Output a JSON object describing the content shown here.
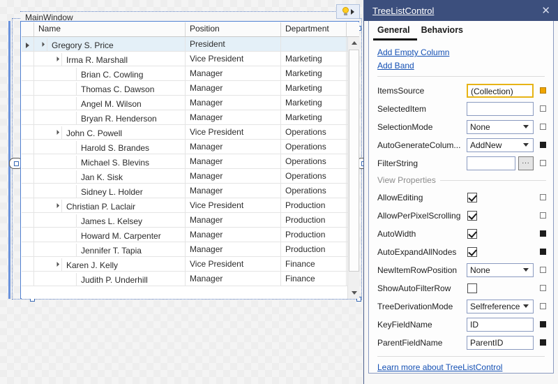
{
  "designer": {
    "window_label": "MainWindow",
    "smart_tag": {
      "bulb_icon": "lightbulb-icon",
      "arrow_icon": "triangle-right-icon"
    }
  },
  "treelist": {
    "columns": [
      "Name",
      "Position",
      "Department"
    ],
    "rows": [
      {
        "level": 0,
        "name": "Gregory S. Price",
        "position": "President",
        "department": "",
        "expander": true,
        "indicator": true,
        "selected": true
      },
      {
        "level": 1,
        "name": "Irma R. Marshall",
        "position": "Vice President",
        "department": "Marketing",
        "expander": true,
        "indicator": false,
        "selected": false
      },
      {
        "level": 2,
        "name": "Brian C. Cowling",
        "position": "Manager",
        "department": "Marketing",
        "expander": false,
        "indicator": false,
        "selected": false
      },
      {
        "level": 2,
        "name": "Thomas C. Dawson",
        "position": "Manager",
        "department": "Marketing",
        "expander": false,
        "indicator": false,
        "selected": false
      },
      {
        "level": 2,
        "name": "Angel M. Wilson",
        "position": "Manager",
        "department": "Marketing",
        "expander": false,
        "indicator": false,
        "selected": false
      },
      {
        "level": 2,
        "name": "Bryan R. Henderson",
        "position": "Manager",
        "department": "Marketing",
        "expander": false,
        "indicator": false,
        "selected": false
      },
      {
        "level": 1,
        "name": "John C. Powell",
        "position": "Vice President",
        "department": "Operations",
        "expander": true,
        "indicator": false,
        "selected": false
      },
      {
        "level": 2,
        "name": "Harold S. Brandes",
        "position": "Manager",
        "department": "Operations",
        "expander": false,
        "indicator": false,
        "selected": false
      },
      {
        "level": 2,
        "name": "Michael S. Blevins",
        "position": "Manager",
        "department": "Operations",
        "expander": false,
        "indicator": false,
        "selected": false
      },
      {
        "level": 2,
        "name": "Jan K. Sisk",
        "position": "Manager",
        "department": "Operations",
        "expander": false,
        "indicator": false,
        "selected": false
      },
      {
        "level": 2,
        "name": "Sidney L. Holder",
        "position": "Manager",
        "department": "Operations",
        "expander": false,
        "indicator": false,
        "selected": false
      },
      {
        "level": 1,
        "name": "Christian P. Laclair",
        "position": "Vice President",
        "department": "Production",
        "expander": true,
        "indicator": false,
        "selected": false
      },
      {
        "level": 2,
        "name": "James L. Kelsey",
        "position": "Manager",
        "department": "Production",
        "expander": false,
        "indicator": false,
        "selected": false
      },
      {
        "level": 2,
        "name": "Howard M. Carpenter",
        "position": "Manager",
        "department": "Production",
        "expander": false,
        "indicator": false,
        "selected": false
      },
      {
        "level": 2,
        "name": "Jennifer T. Tapia",
        "position": "Manager",
        "department": "Production",
        "expander": false,
        "indicator": false,
        "selected": false
      },
      {
        "level": 1,
        "name": "Karen J. Kelly",
        "position": "Vice President",
        "department": "Finance",
        "expander": true,
        "indicator": false,
        "selected": false
      },
      {
        "level": 2,
        "name": "Judith P. Underhill",
        "position": "Manager",
        "department": "Finance",
        "expander": false,
        "indicator": false,
        "selected": false
      }
    ]
  },
  "panel": {
    "title": "TreeListControl",
    "close_label": "✕",
    "tabs": [
      {
        "label": "General",
        "active": true
      },
      {
        "label": "Behaviors",
        "active": false
      }
    ],
    "actions": [
      {
        "label": "Add Empty Column"
      },
      {
        "label": "Add Band"
      }
    ],
    "properties": [
      {
        "label": "ItemsSource",
        "type": "text",
        "value": "(Collection)",
        "highlight": true,
        "marker": "orange"
      },
      {
        "label": "SelectedItem",
        "type": "text",
        "value": "",
        "highlight": false,
        "marker": "empty"
      },
      {
        "label": "SelectionMode",
        "type": "combo",
        "value": "None",
        "marker": "empty"
      },
      {
        "label": "AutoGenerateColum...",
        "type": "combo",
        "value": "AddNew",
        "marker": "black"
      },
      {
        "label": "FilterString",
        "type": "text-btn",
        "value": "",
        "button": "...",
        "marker": "empty"
      }
    ],
    "view_section_label": "View Properties",
    "view_properties": [
      {
        "label": "AllowEditing",
        "type": "check",
        "checked": true,
        "marker": "empty"
      },
      {
        "label": "AllowPerPixelScrolling",
        "type": "check",
        "checked": true,
        "marker": "empty"
      },
      {
        "label": "AutoWidth",
        "type": "check",
        "checked": true,
        "marker": "black"
      },
      {
        "label": "AutoExpandAllNodes",
        "type": "check",
        "checked": true,
        "marker": "black"
      },
      {
        "label": "NewItemRowPosition",
        "type": "combo",
        "value": "None",
        "marker": "empty"
      },
      {
        "label": "ShowAutoFilterRow",
        "type": "check",
        "checked": false,
        "marker": "empty"
      },
      {
        "label": "TreeDerivationMode",
        "type": "combo",
        "value": "Selfreference",
        "marker": "empty"
      },
      {
        "label": "KeyFieldName",
        "type": "text",
        "value": "ID",
        "marker": "black"
      },
      {
        "label": "ParentFieldName",
        "type": "text",
        "value": "ParentID",
        "marker": "black"
      }
    ],
    "footer_link": "Learn more about TreeListControl"
  },
  "colors": {
    "panel_title_bg": "#3c4f7d",
    "link": "#1450b4",
    "highlight_border": "#e7b416",
    "selected_row": "#e4f0f8",
    "adorner": "#5b7fc4"
  }
}
